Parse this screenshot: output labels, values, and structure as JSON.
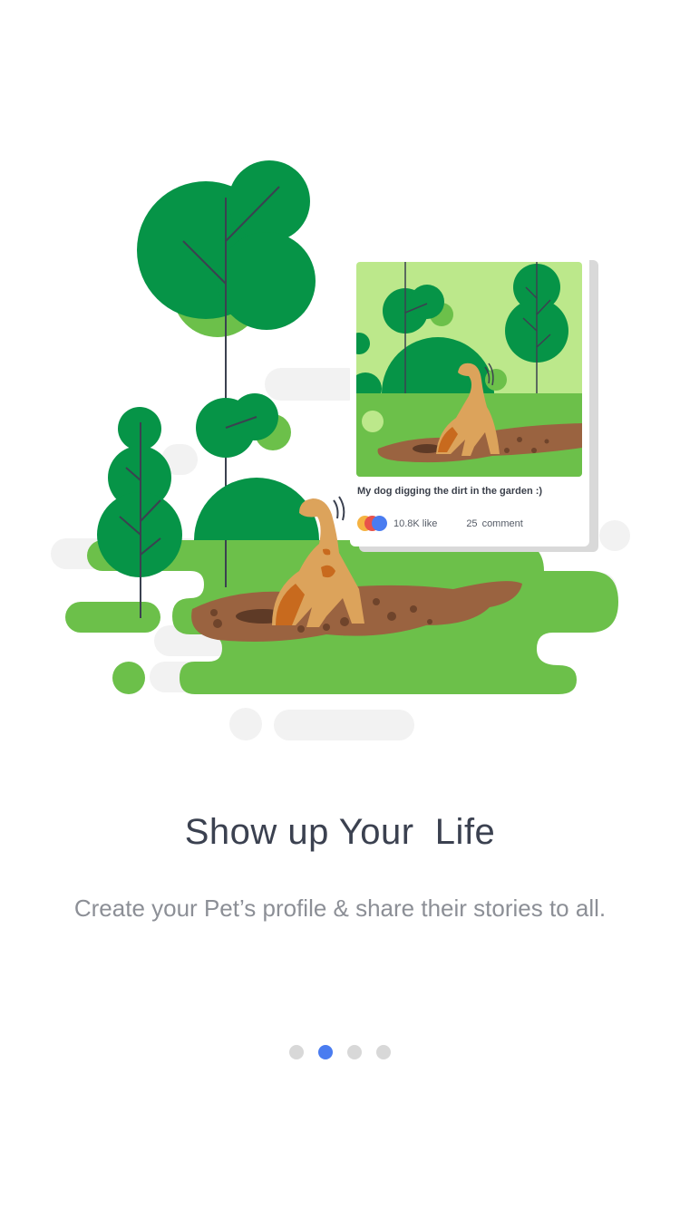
{
  "onboarding": {
    "title": "Show up Your  Life",
    "subtitle": "Create your Pet’s profile & share their stories to all.",
    "page_count": 4,
    "active_page": 2
  },
  "post_card": {
    "caption": "My dog digging the dirt in the garden :)",
    "likes": "10.8K like",
    "comment_count": "25",
    "comment_label": "comment",
    "avatar_colors": [
      "#f5b342",
      "#e8534a",
      "#4a7cf0"
    ]
  },
  "colors": {
    "accent": "#4a7cf0",
    "dark_green": "#069447",
    "light_green": "#6cc04a",
    "soil": "#9a6340",
    "dog": "#dca35b",
    "dot_inactive": "#d8d8d8"
  },
  "icons": [
    "tree-icon",
    "dog-icon",
    "avatar-stack-icon"
  ]
}
